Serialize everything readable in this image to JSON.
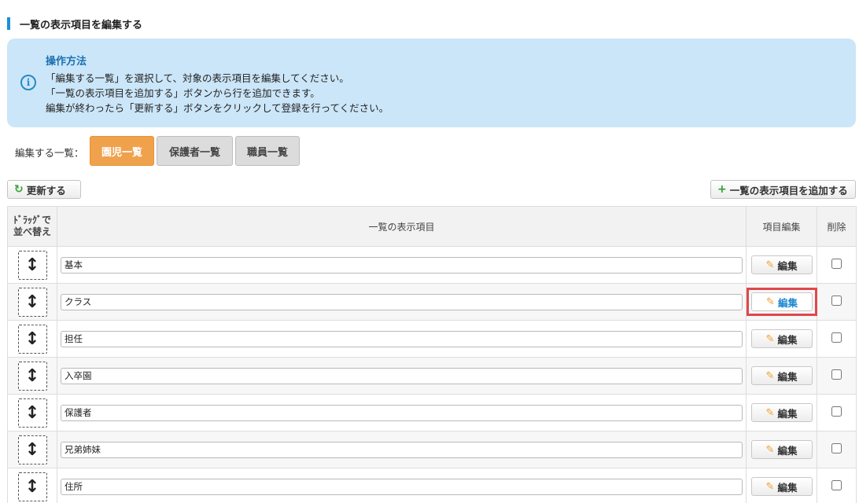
{
  "page": {
    "title": "一覧の表示項目を編集する"
  },
  "instructions": {
    "title": "操作方法",
    "line1": "「編集する一覧」を選択して、対象の表示項目を編集してください。",
    "line2": "「一覧の表示項目を追加する」ボタンから行を追加できます。",
    "line3": "編集が終わったら「更新する」ボタンをクリックして登録を行ってください。"
  },
  "list_selector": {
    "label": "編集する一覧：",
    "options": [
      "園児一覧",
      "保護者一覧",
      "職員一覧"
    ],
    "selected": "園児一覧"
  },
  "toolbar": {
    "refresh_label": "更新する",
    "add_label": "一覧の表示項目を追加する"
  },
  "table": {
    "headers": {
      "drag_line1": "ﾄﾞﾗｯｸﾞで",
      "drag_line2": "並べ替え",
      "item": "一覧の表示項目",
      "edit": "項目編集",
      "delete": "削除"
    },
    "edit_label": "編集",
    "rows": [
      {
        "value": "基本"
      },
      {
        "value": "クラス"
      },
      {
        "value": "担任"
      },
      {
        "value": "入卒園"
      },
      {
        "value": "保護者"
      },
      {
        "value": "兄弟姉妹"
      },
      {
        "value": "住所"
      }
    ]
  },
  "colors": {
    "accent": "#1a8fd6",
    "active_tab": "#f0a14c",
    "info_bg": "#cbe6f8",
    "highlight": "#e0474c"
  }
}
